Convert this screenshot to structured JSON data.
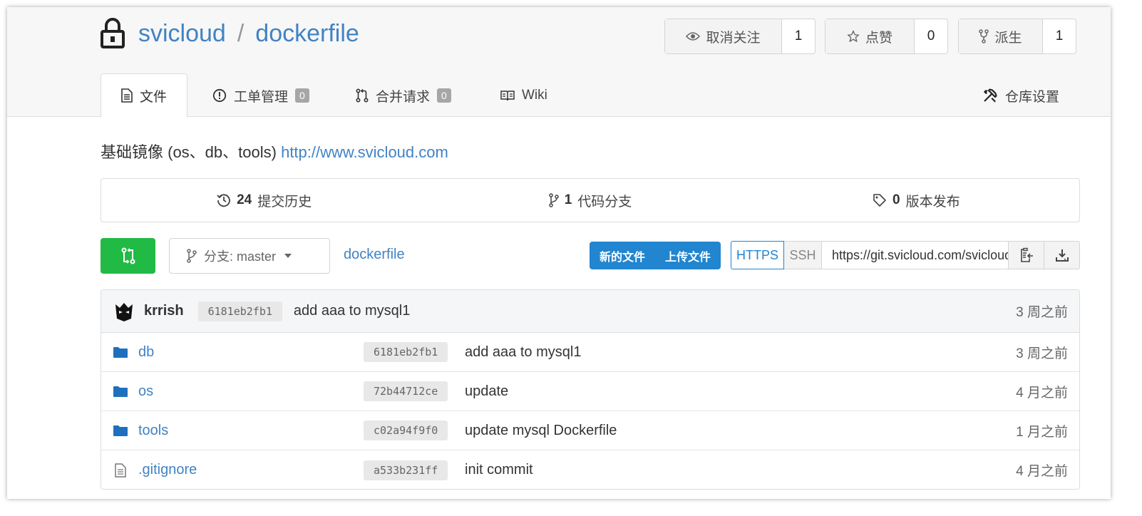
{
  "repo": {
    "owner": "svicloud",
    "separator": "/",
    "name": "dockerfile"
  },
  "actions": {
    "watch": {
      "label": "取消关注",
      "count": "1"
    },
    "star": {
      "label": "点赞",
      "count": "0"
    },
    "fork": {
      "label": "派生",
      "count": "1"
    }
  },
  "tabs": [
    {
      "label": "文件",
      "icon": "file-text-icon",
      "active": true
    },
    {
      "label": "工单管理",
      "icon": "issue-icon",
      "badge": "0"
    },
    {
      "label": "合并请求",
      "icon": "pull-request-icon",
      "badge": "0"
    },
    {
      "label": "Wiki",
      "icon": "book-icon"
    }
  ],
  "settings_tab": {
    "label": "仓库设置",
    "icon": "tools-icon"
  },
  "description": {
    "text": "基础镜像 (os、db、tools)",
    "link": "http://www.svicloud.com"
  },
  "stats": {
    "commits": {
      "count": "24",
      "label": "提交历史"
    },
    "branches": {
      "count": "1",
      "label": "代码分支"
    },
    "releases": {
      "count": "0",
      "label": "版本发布"
    }
  },
  "toolbar": {
    "branch_label": "分支: master",
    "breadcrumb": "dockerfile",
    "new_file": "新的文件",
    "upload_file": "上传文件",
    "https": "HTTPS",
    "ssh": "SSH",
    "clone_url": "https://git.svicloud.com/svicloud/dockerfile.git"
  },
  "last_commit": {
    "author": "krrish",
    "sha": "6181eb2fb1",
    "message": "add aaa to mysql1",
    "time": "3 周之前"
  },
  "files": [
    {
      "name": "db",
      "type": "folder",
      "sha": "6181eb2fb1",
      "message": "add aaa to mysql1",
      "time": "3 周之前"
    },
    {
      "name": "os",
      "type": "folder",
      "sha": "72b44712ce",
      "message": "update",
      "time": "4 月之前"
    },
    {
      "name": "tools",
      "type": "folder",
      "sha": "c02a94f9f0",
      "message": "update mysql Dockerfile",
      "time": "1 月之前"
    },
    {
      "name": ".gitignore",
      "type": "file",
      "sha": "a533b231ff",
      "message": "init commit",
      "time": "4 月之前"
    }
  ],
  "colors": {
    "link": "#4183c4",
    "primary": "#2185d0",
    "green": "#21ba45"
  }
}
